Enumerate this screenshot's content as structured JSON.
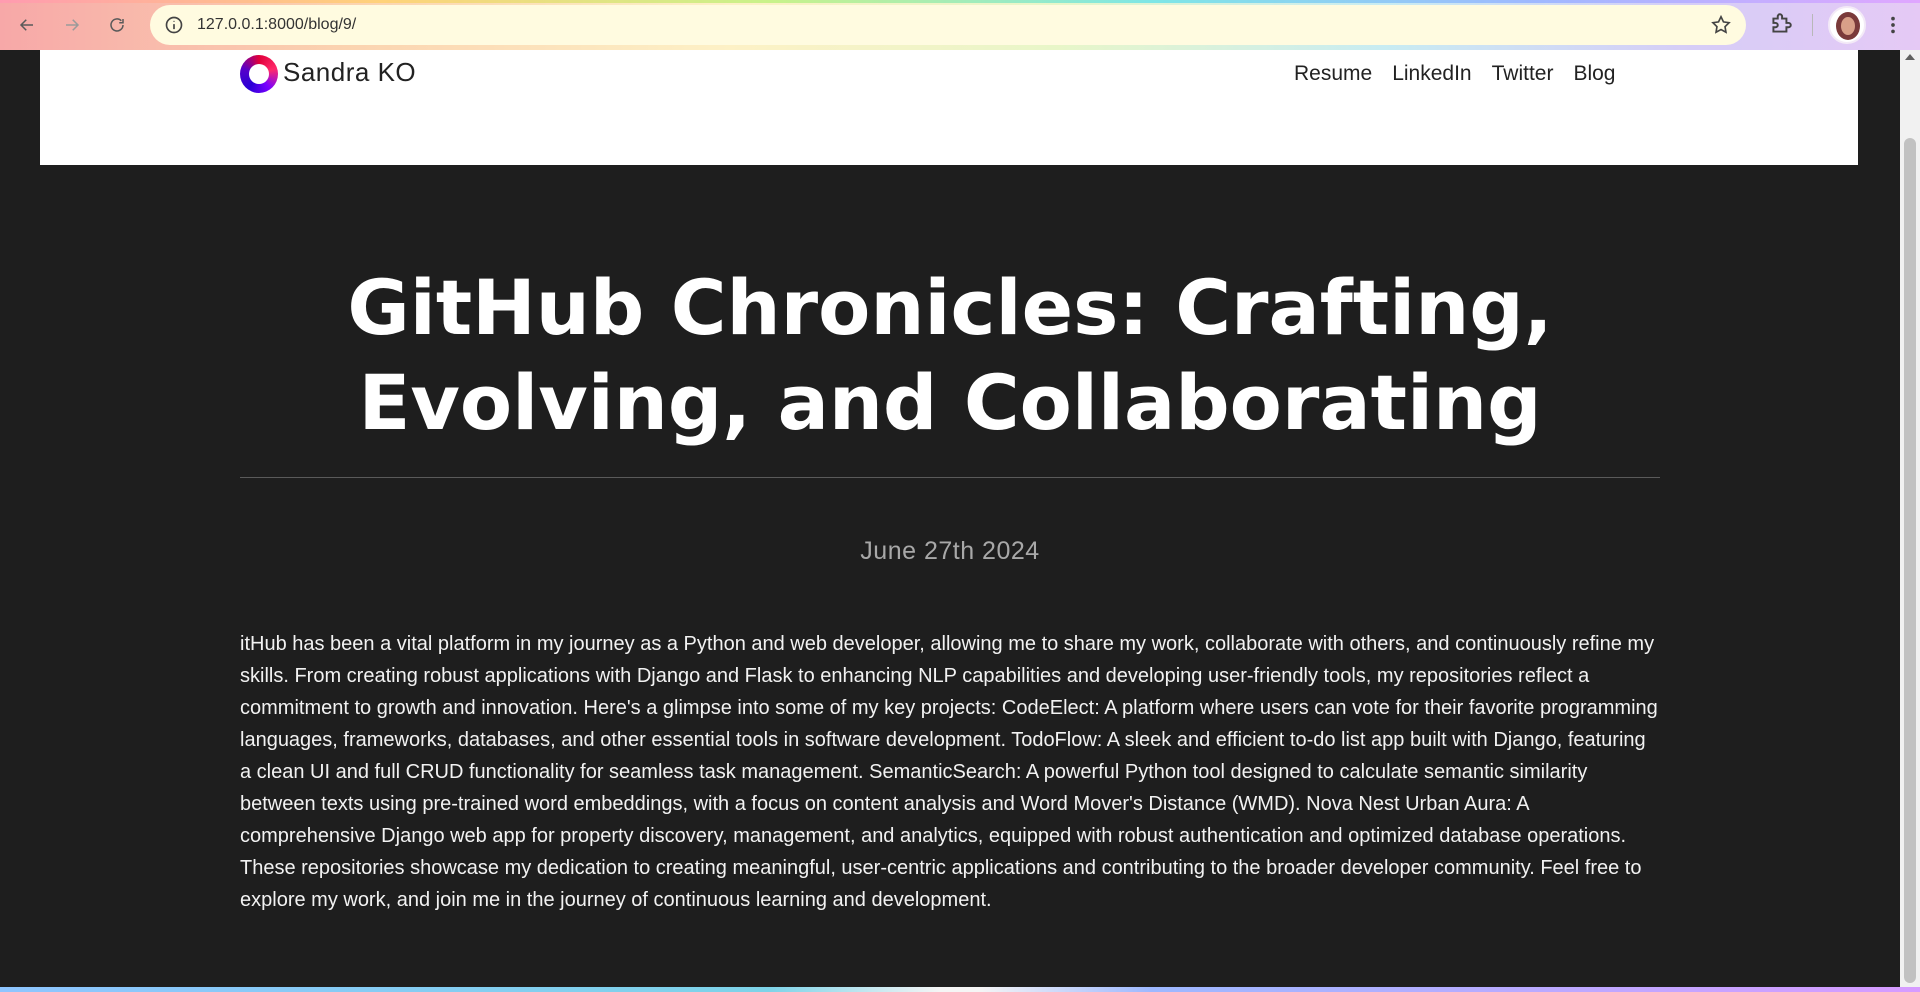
{
  "browser": {
    "url": "127.0.0.1:8000/blog/9/"
  },
  "site": {
    "brand": "Sandra KO",
    "nav": {
      "resume": "Resume",
      "linkedin": "LinkedIn",
      "twitter": "Twitter",
      "blog": "Blog"
    }
  },
  "post": {
    "title": "GitHub Chronicles: Crafting, Evolving, and Collaborating",
    "date": "June 27th 2024",
    "body": "itHub has been a vital platform in my journey as a Python and web developer, allowing me to share my work, collaborate with others, and continuously refine my skills. From creating robust applications with Django and Flask to enhancing NLP capabilities and developing user-friendly tools, my repositories reflect a commitment to growth and innovation. Here's a glimpse into some of my key projects: CodeElect: A platform where users can vote for their favorite programming languages, frameworks, databases, and other essential tools in software development. TodoFlow: A sleek and efficient to-do list app built with Django, featuring a clean UI and full CRUD functionality for seamless task management. SemanticSearch: A powerful Python tool designed to calculate semantic similarity between texts using pre-trained word embeddings, with a focus on content analysis and Word Mover's Distance (WMD). Nova Nest Urban Aura: A comprehensive Django web app for property discovery, management, and analytics, equipped with robust authentication and optimized database operations. These repositories showcase my dedication to creating meaningful, user-centric applications and contributing to the broader developer community. Feel free to explore my work, and join me in the journey of continuous learning and development."
  },
  "icons": {
    "back": "back-arrow-icon",
    "forward": "forward-arrow-icon",
    "reload": "reload-icon",
    "info": "info-icon",
    "bookmark": "star-icon",
    "extensions": "puzzle-icon",
    "menu": "kebab-menu-icon"
  },
  "colors": {
    "page_background": "#1e1e1e",
    "header_background": "#ffffff",
    "title_color": "#ffffff",
    "date_color": "#a8a8a8"
  }
}
